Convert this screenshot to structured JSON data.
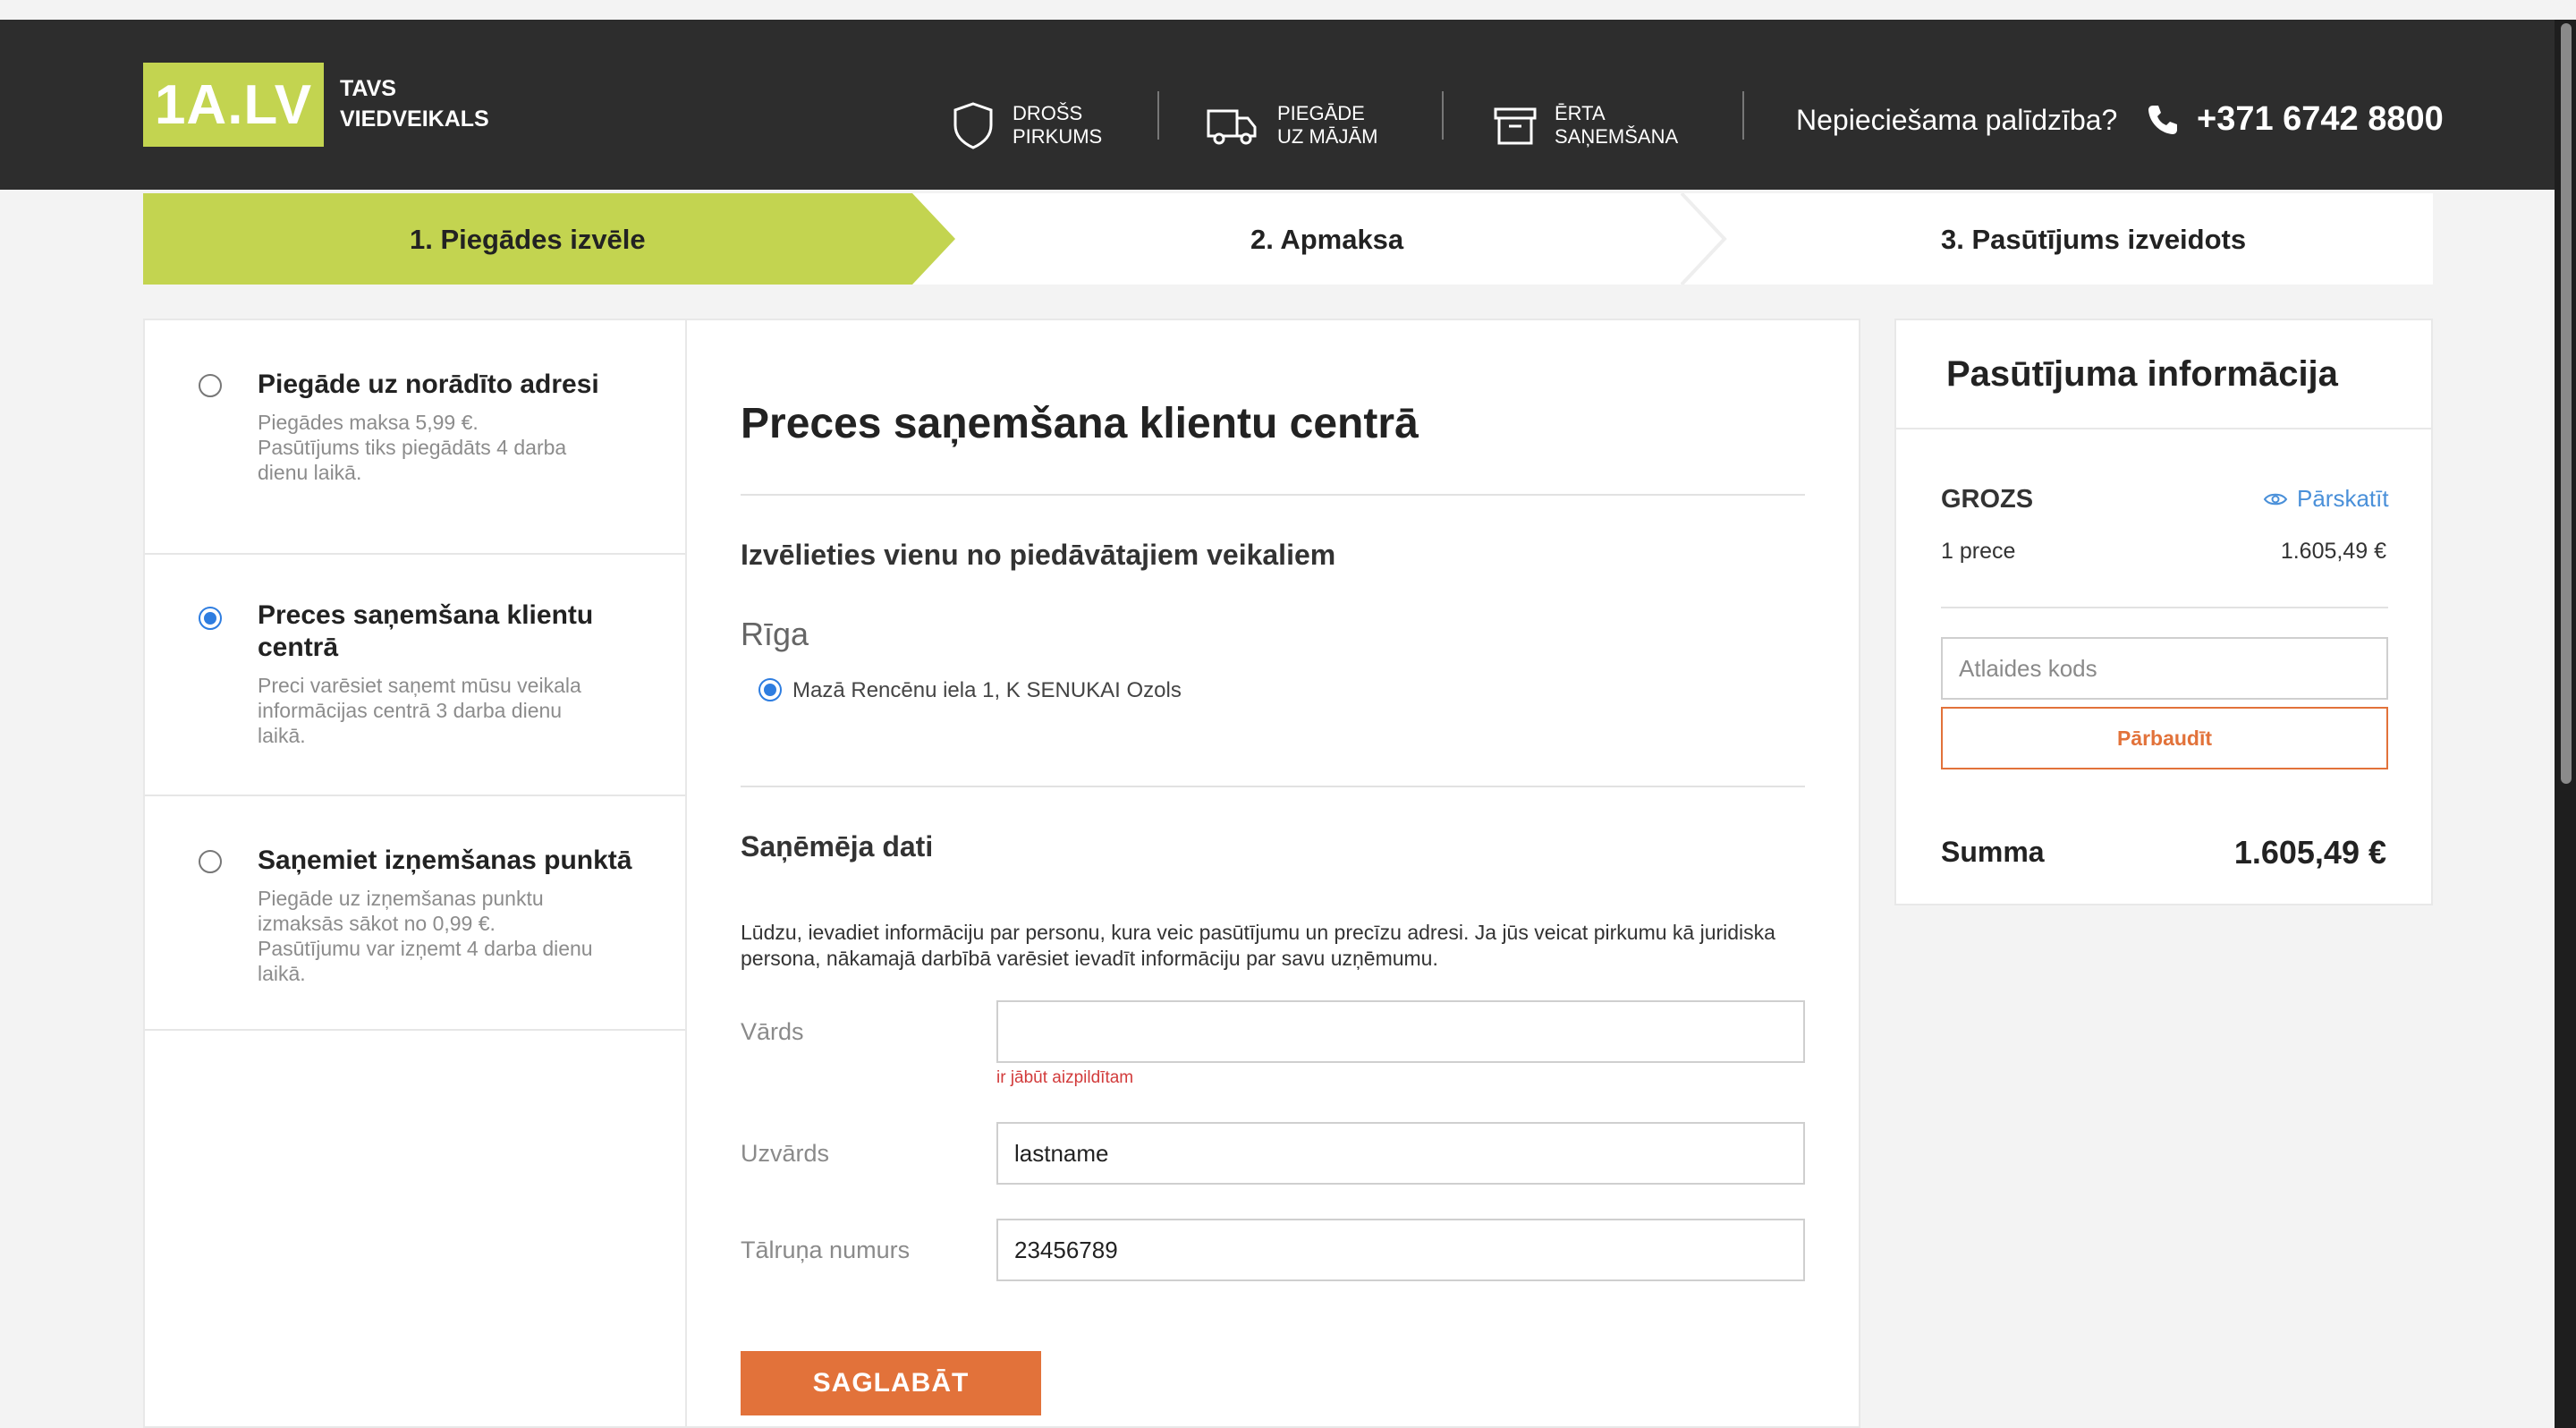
{
  "header": {
    "logo_text": "1A.LV",
    "tagline": "TAVS VIEDVEIKALS",
    "features": [
      {
        "icon": "shield-icon",
        "label": "DROŠS\nPIRKUMS"
      },
      {
        "icon": "truck-icon",
        "label": "PIEGĀDE\nUZ MĀJĀM"
      },
      {
        "icon": "box-icon",
        "label": "ĒRTA\nSAŅEMŠANA"
      }
    ],
    "help_text": "Nepieciešama palīdzība?",
    "phone": "+371 6742 8800"
  },
  "steps": [
    {
      "label": "1. Piegādes izvēle",
      "active": true
    },
    {
      "label": "2. Apmaksa",
      "active": false
    },
    {
      "label": "3. Pasūtījums izveidots",
      "active": false
    }
  ],
  "delivery_options": [
    {
      "title": "Piegāde uz norādīto adresi",
      "desc": "Piegādes maksa 5,99 €.\nPasūtījums tiks piegādāts 4 darba\ndienu laikā.",
      "selected": false
    },
    {
      "title": "Preces saņemšana klientu centrā",
      "desc": "Preci varēsiet saņemt mūsu veikala\ninformācijas centrā 3 darba dienu\nlaikā.",
      "selected": true
    },
    {
      "title": "Saņemiet izņemšanas punktā",
      "desc": "Piegāde uz izņemšanas punktu\nizmaksās sākot no 0,99 €.\nPasūtījumu var izņemt 4 darba dienu\nlaikā.",
      "selected": false
    }
  ],
  "main": {
    "title": "Preces saņemšana klientu centrā",
    "store_heading": "Izvēlieties vienu no piedāvātajiem veikaliem",
    "city": "Rīga",
    "store": "Mazā Rencēnu iela 1, K SENUKAI Ozols",
    "recipient_heading": "Saņēmēja dati",
    "info": "Lūdzu, ievadiet informāciju par personu, kura veic pasūtījumu un precīzu adresi. Ja jūs veicat pirkumu kā juridiska persona, nākamajā darbībā varēsiet ievadīt informāciju par savu uzņēmumu.",
    "fields": {
      "first_name": {
        "label": "Vārds",
        "value": "",
        "error": "ir jābūt aizpildītam"
      },
      "last_name": {
        "label": "Uzvārds",
        "value": "lastname"
      },
      "phone": {
        "label": "Tālruņa numurs",
        "value": "23456789"
      }
    },
    "save_label": "SAGLABĀT"
  },
  "summary": {
    "title": "Pasūtījuma informācija",
    "cart_label": "GROZS",
    "review_label": "Pārskatīt",
    "item_count": "1 prece",
    "item_price": "1.605,49 €",
    "coupon_placeholder": "Atlaides kods",
    "check_label": "Pārbaudīt",
    "sum_label": "Summa",
    "sum_value": "1.605,49 €"
  },
  "colors": {
    "brand_green": "#c3d450",
    "accent_orange": "#e2723a",
    "header_bg": "#2d2d2d",
    "link_blue": "#4a90d9",
    "error_red": "#d23b3b"
  }
}
